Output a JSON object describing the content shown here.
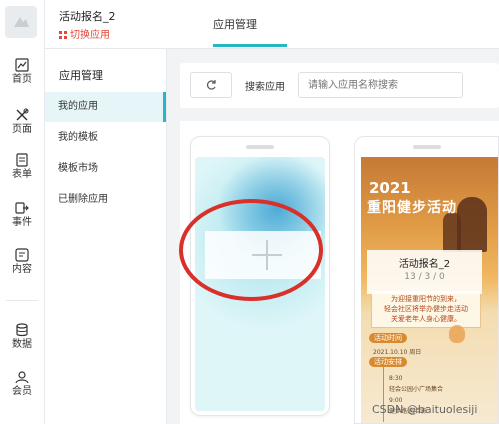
{
  "rail": {
    "items": [
      {
        "label": "首页",
        "icon": "chart-icon"
      },
      {
        "label": "页面",
        "icon": "tools-icon"
      },
      {
        "label": "表单",
        "icon": "form-icon"
      },
      {
        "label": "事件",
        "icon": "event-icon"
      },
      {
        "label": "内容",
        "icon": "content-icon"
      },
      {
        "label": "数据",
        "icon": "database-icon"
      },
      {
        "label": "会员",
        "icon": "user-icon"
      }
    ]
  },
  "header": {
    "app_name": "活动报名_2",
    "switch_label": "切换应用",
    "tab": "应用管理"
  },
  "sidenav": {
    "title": "应用管理",
    "items": [
      "我的应用",
      "我的模板",
      "模板市场",
      "已删除应用"
    ],
    "active_index": 0
  },
  "toolbar": {
    "search_label": "搜索应用",
    "search_placeholder": "请输入应用名称搜索"
  },
  "apps": [
    {
      "name": "活动报名_2",
      "counts": "13 / 3 / 0",
      "poster": {
        "year": "2021",
        "title": "重阳健步活动",
        "desc": "为迎接重阳节的到来，\n轻会社区将举办健步走活动\n关爱老年人身心健康。",
        "time_pill": "活动时间",
        "time": "2021.10.10 周日",
        "plan_pill": "活动安排",
        "step1_time": "8:30",
        "step1": "轻会公园小广场集合",
        "step2_time": "9:00",
        "step2": "健步路途/合影"
      }
    }
  ],
  "watermark": "CSDN @baituolesiji",
  "colors": {
    "accent": "#29b6c4",
    "switch": "#e2493b",
    "annotation": "#d9302a"
  }
}
